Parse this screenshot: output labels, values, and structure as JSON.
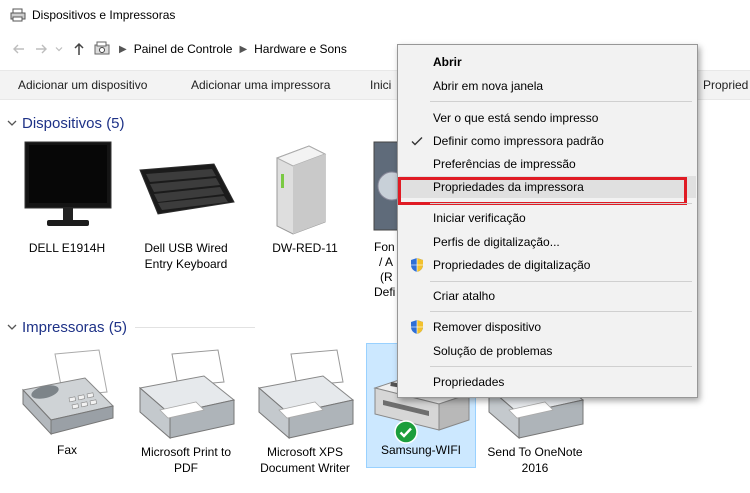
{
  "window": {
    "title": "Dispositivos e Impressoras"
  },
  "address": {
    "crumbs": [
      "Painel de Controle",
      "Hardware e Sons"
    ]
  },
  "commands": {
    "add_device": "Adicionar um dispositivo",
    "add_printer": "Adicionar uma impressora",
    "partial_left": "Inici",
    "partial_right": "Propried"
  },
  "groups": {
    "devices": {
      "title": "Dispositivos (5)",
      "items": [
        {
          "label": "DELL E1914H"
        },
        {
          "label": "Dell USB Wired Entry Keyboard"
        },
        {
          "label": "DW-RED-11"
        },
        {
          "label_lines": [
            "Fon",
            "/ A",
            "(R",
            "Defi"
          ]
        }
      ]
    },
    "printers": {
      "title": "Impressoras (5)",
      "items": [
        {
          "label": "Fax"
        },
        {
          "label": "Microsoft Print to PDF"
        },
        {
          "label": "Microsoft XPS Document Writer"
        },
        {
          "label": "Samsung-WIFI"
        },
        {
          "label": "Send To OneNote 2016"
        }
      ]
    }
  },
  "context_menu": {
    "items": [
      {
        "label": "Abrir",
        "bold": true
      },
      {
        "label": "Abrir em nova janela"
      },
      {
        "label": "Ver o que está sendo impresso"
      },
      {
        "label": "Definir como impressora padrão",
        "icon": "check-icon"
      },
      {
        "label": "Preferências de impressão"
      },
      {
        "label": "Propriedades da impressora",
        "highlighted": true
      },
      {
        "label": "Iniciar verificação"
      },
      {
        "label": "Perfis de digitalização..."
      },
      {
        "label": "Propriedades de digitalização",
        "icon": "shield-icon"
      },
      {
        "label": "Criar atalho"
      },
      {
        "label": "Remover dispositivo",
        "icon": "shield-icon"
      },
      {
        "label": "Solução de problemas"
      },
      {
        "label": "Propriedades"
      }
    ]
  },
  "colors": {
    "group_title": "#1e3287",
    "highlight_border": "#e01b24",
    "selection": "#cce8ff",
    "default_check": "#1c9e3c"
  }
}
